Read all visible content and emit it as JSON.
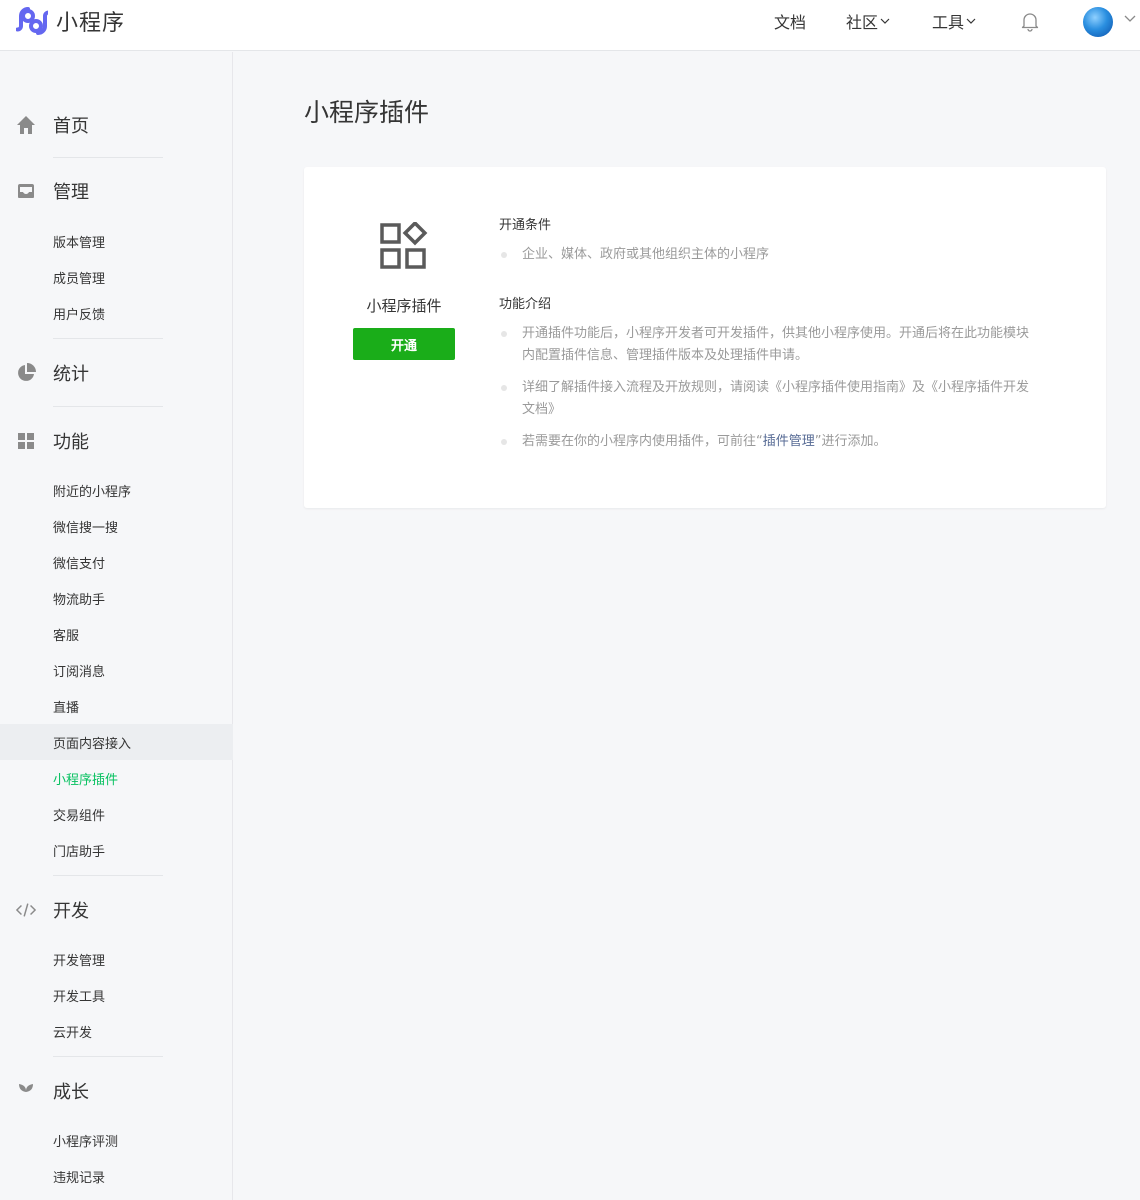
{
  "header": {
    "logo_text": "小程序",
    "nav": [
      {
        "label": "文档"
      },
      {
        "label": "社区"
      },
      {
        "label": "工具"
      }
    ],
    "icons": {
      "bell": "bell-icon",
      "avatar": "avatar",
      "chevron": "chevron-down-icon"
    }
  },
  "sidebar": {
    "home": {
      "label": "首页",
      "icon": "home-icon"
    },
    "manage": {
      "label": "管理",
      "icon": "inbox-icon",
      "items": [
        "版本管理",
        "成员管理",
        "用户反馈"
      ]
    },
    "stats": {
      "label": "统计",
      "icon": "pie-chart-icon"
    },
    "features": {
      "label": "功能",
      "icon": "grid-icon",
      "items": [
        "附近的小程序",
        "微信搜一搜",
        "微信支付",
        "物流助手",
        "客服",
        "订阅消息",
        "直播",
        "页面内容接入",
        "小程序插件",
        "交易组件",
        "门店助手"
      ]
    },
    "dev": {
      "label": "开发",
      "icon": "code-icon",
      "items": [
        "开发管理",
        "开发工具",
        "云开发"
      ]
    },
    "growth": {
      "label": "成长",
      "icon": "sprout-icon",
      "items": [
        "小程序评测",
        "违规记录"
      ]
    },
    "active_color": "#07c160"
  },
  "main": {
    "title": "小程序插件",
    "card": {
      "plugin_name": "小程序插件",
      "enable_button": "开通",
      "conditions_title": "开通条件",
      "conditions": [
        "企业、媒体、政府或其他组织主体的小程序"
      ],
      "intro_title": "功能介绍",
      "intro_1_line1": "开通插件功能后，小程序开发者可开发插件，供其他小程序使用。开通后将在此功能模块",
      "intro_1_line2": "内配置插件信息、管理插件版本及处理插件申请。",
      "intro_2_line1": "详细了解插件接入流程及开放规则，请阅读《小程序插件使用指南》及《小程序插件开发",
      "intro_2_line2": "文档》",
      "intro_3_before": "若需要在你的小程序内使用插件，可前往“",
      "intro_3_link": "插件管理",
      "intro_3_after": "”进行添加。",
      "button_color": "#1aad19",
      "link_color": "#576b95"
    }
  }
}
